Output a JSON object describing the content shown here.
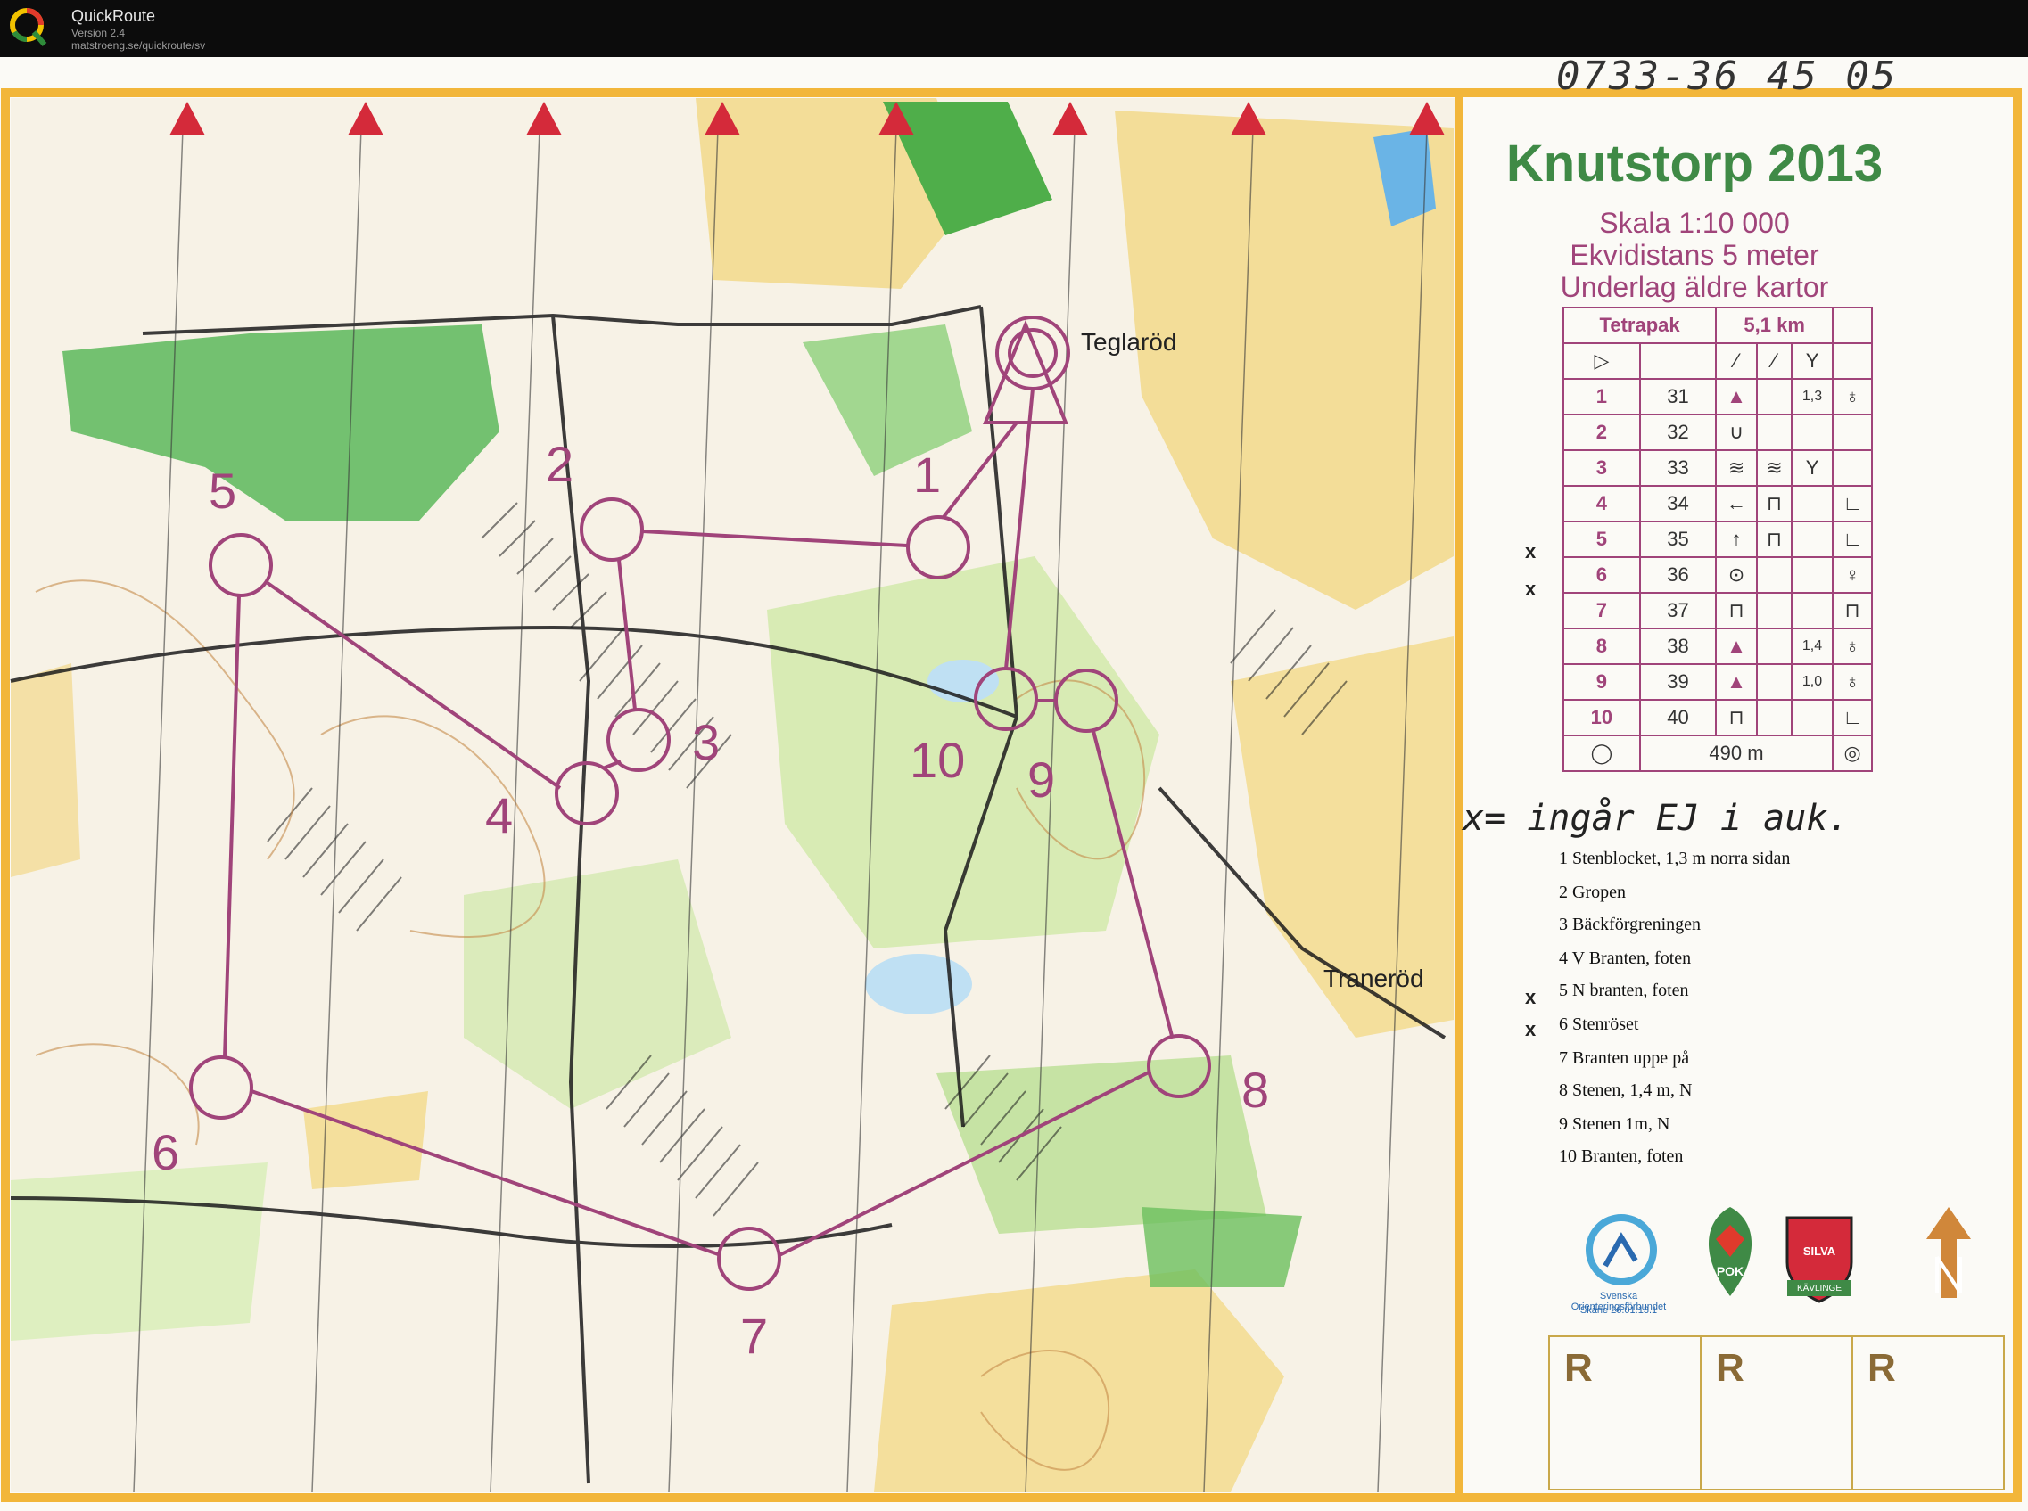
{
  "app": {
    "title": "QuickRoute",
    "version": "Version 2.4",
    "url": "matstroeng.se/quickroute/sv"
  },
  "map": {
    "phone_note": "0733-36 45 05",
    "title": "Knutstorp 2013",
    "scale": "Skala 1:10 000",
    "contour": "Ekvidistans 5 meter",
    "base": "Underlag äldre kartor",
    "places": [
      "Teglaröd",
      "Traneröd"
    ],
    "course": {
      "name": "Tetrapak",
      "length": "5,1 km",
      "finish_distance": "490 m",
      "controls": [
        {
          "num": "1",
          "code": "31",
          "dim": "1,3"
        },
        {
          "num": "2",
          "code": "32",
          "dim": ""
        },
        {
          "num": "3",
          "code": "33",
          "dim": ""
        },
        {
          "num": "4",
          "code": "34",
          "dim": ""
        },
        {
          "num": "5",
          "code": "35",
          "dim": ""
        },
        {
          "num": "6",
          "code": "36",
          "dim": ""
        },
        {
          "num": "7",
          "code": "37",
          "dim": ""
        },
        {
          "num": "8",
          "code": "38",
          "dim": "1,4"
        },
        {
          "num": "9",
          "code": "39",
          "dim": "1,0"
        },
        {
          "num": "10",
          "code": "40",
          "dim": ""
        }
      ]
    },
    "hand_note": "x= ingår EJ i auk.",
    "control_descriptions": [
      "1 Stenblocket, 1,3 m norra sidan",
      "2 Gropen",
      "3 Bäckförgreningen",
      "4 V Branten, foten",
      "5 N branten, foten",
      "6 Stenröset",
      "7 Branten uppe på",
      "8 Stenen, 1,4 m, N",
      "9 Stenen 1m, N",
      "10 Branten, foten"
    ],
    "struck_marks": [
      "x",
      "x",
      "x",
      "x"
    ],
    "map_control_labels": [
      "1",
      "2",
      "3",
      "4",
      "5",
      "6",
      "7",
      "8",
      "9",
      "10"
    ],
    "logos": {
      "sof_name": "Svenska Orienteringsförbundet",
      "sof_date": "Skåne 26.01.13.1",
      "pok": "POK",
      "silva": "SILVA",
      "kavlinge": "KÄVLINGE"
    },
    "r_boxes": [
      "R",
      "R",
      "R"
    ],
    "colors": {
      "course": "#a0447a",
      "forest_green": "#4fae4a",
      "open_yellow": "#f2d98a",
      "legend_green": "#3f8a46",
      "frame_orange": "#f2b63a"
    }
  }
}
